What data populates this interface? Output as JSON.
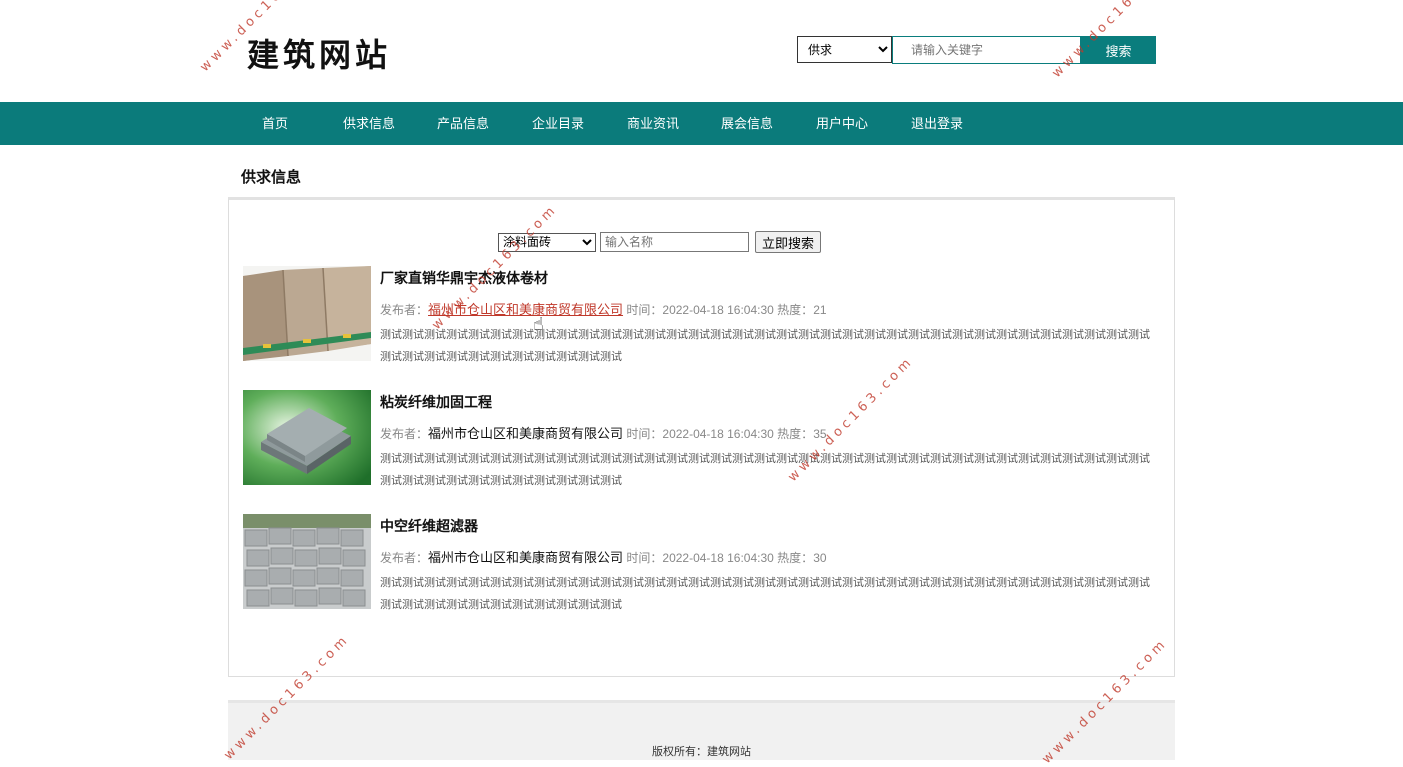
{
  "header": {
    "logo": "建筑网站",
    "search_type_selected": "供求",
    "search_placeholder": "请输入关键字",
    "search_button": "搜索"
  },
  "nav": [
    "首页",
    "供求信息",
    "产品信息",
    "企业目录",
    "商业资讯",
    "展会信息",
    "用户中心",
    "退出登录"
  ],
  "page": {
    "section_title": "供求信息",
    "filter": {
      "category_selected": "涂料面砖",
      "name_placeholder": "输入名称",
      "search_button": "立即搜索"
    },
    "items": [
      {
        "title": "厂家直销华鼎宇杰液体卷材",
        "publisher_label": "发布者：",
        "publisher": "福州市仓山区和美康商贸有限公司",
        "time_label": "时间：",
        "time": "2022-04-18 16:04:30",
        "heat_label": "热度：",
        "heat": "21",
        "desc": "测试测试测试测试测试测试测试测试测试测试测试测试测试测试测试测试测试测试测试测试测试测试测试测试测试测试测试测试测试测试测试测试测试测试测试测试测试测试测试测试测试测试测试测试测试测试",
        "image": "beige-panels"
      },
      {
        "title": "粘炭纤维加固工程",
        "publisher_label": "发布者：",
        "publisher": "福州市仓山区和美康商贸有限公司",
        "time_label": "时间：",
        "time": "2022-04-18 16:04:30",
        "heat_label": "热度：",
        "heat": "35",
        "desc": "测试测试测试测试测试测试测试测试测试测试测试测试测试测试测试测试测试测试测试测试测试测试测试测试测试测试测试测试测试测试测试测试测试测试测试测试测试测试测试测试测试测试测试测试测试测试",
        "image": "grey-board-on-green"
      },
      {
        "title": "中空纤维超滤器",
        "publisher_label": "发布者：",
        "publisher": "福州市仓山区和美康商贸有限公司",
        "time_label": "时间：",
        "time": "2022-04-18 16:04:30",
        "heat_label": "热度：",
        "heat": "30",
        "desc": "测试测试测试测试测试测试测试测试测试测试测试测试测试测试测试测试测试测试测试测试测试测试测试测试测试测试测试测试测试测试测试测试测试测试测试测试测试测试测试测试测试测试测试测试测试测试",
        "image": "stacked-blocks"
      }
    ]
  },
  "footer": {
    "copyright": "版权所有：建筑网站"
  },
  "watermark": "www.doc163.com",
  "colors": {
    "primary": "#0b7b7b",
    "link_hover": "#c0392b"
  }
}
